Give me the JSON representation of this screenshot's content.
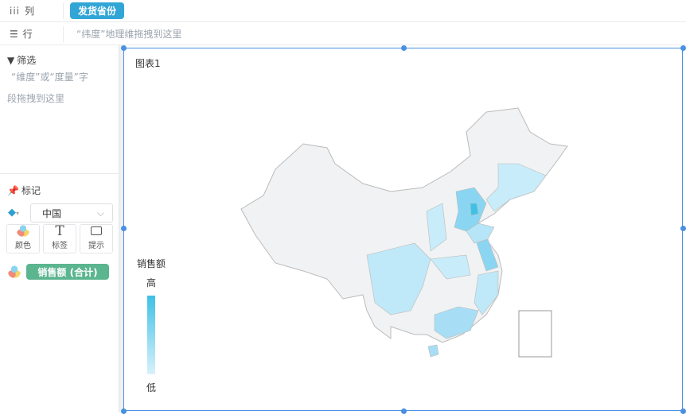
{
  "shelf": {
    "columns_label": "列",
    "columns_field": "发货省份",
    "rows_label": "行",
    "rows_hint": "“纬度”地理维拖拽到这里"
  },
  "filter": {
    "title": "筛选",
    "hint_line1": "“维度”或“度量”字",
    "hint_line2": "段拖拽到这里"
  },
  "marks": {
    "title": "标记",
    "map_select": "中国",
    "buttons": [
      {
        "label": "颜色"
      },
      {
        "label": "标签"
      },
      {
        "label": "提示"
      }
    ],
    "color_field": "销售额 (合计)"
  },
  "chart": {
    "title": "图表1",
    "legend_title": "销售额",
    "legend_high": "高",
    "legend_low": "低"
  },
  "colors": {
    "accent": "#31a6d6",
    "green": "#5bb58f",
    "map_base": "#f0f2f3",
    "high": "#3ec1e6",
    "low": "#d8f1fb"
  }
}
